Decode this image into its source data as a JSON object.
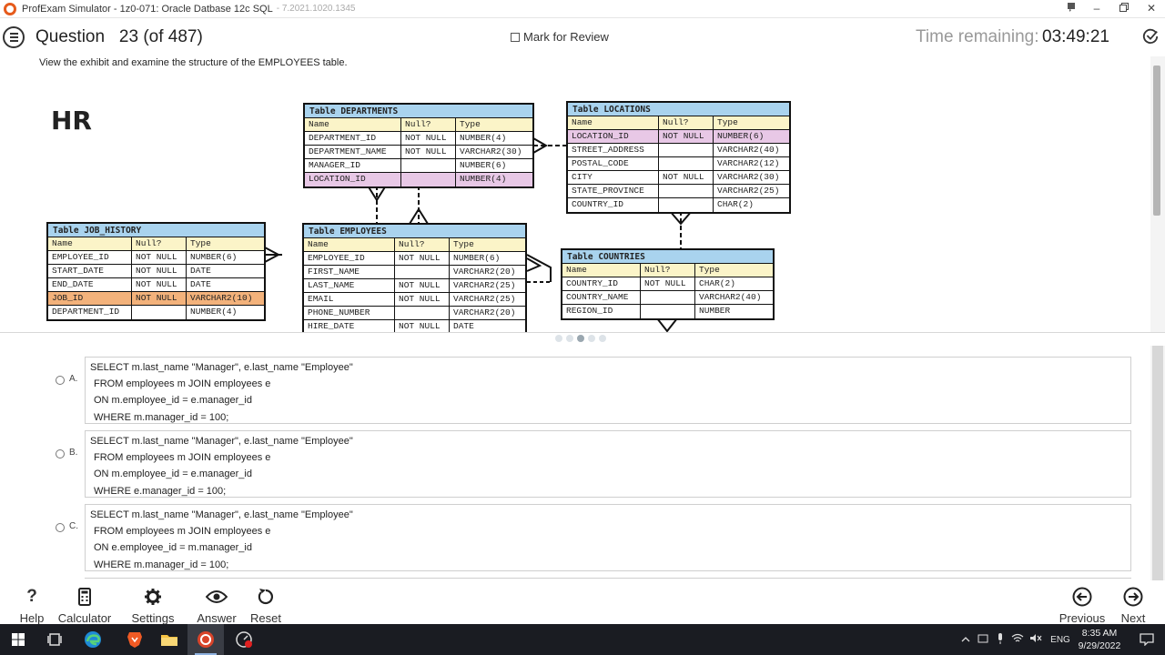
{
  "window": {
    "title": "ProfExam Simulator - 1z0-071: Oracle Datbase 12c SQL",
    "version": "- 7.2021.1020.1345"
  },
  "header": {
    "question_label": "Question",
    "question_number": "23",
    "question_of": "(of 487)",
    "mark_review": "Mark for Review",
    "time_label": "Time remaining:",
    "time_value": "03:49:21"
  },
  "question": {
    "text": "View the exhibit and examine the structure of the EMPLOYEES table.",
    "schema_label": "HR"
  },
  "exhibit": {
    "departments": {
      "title": "Table DEPARTMENTS",
      "columns": [
        "Name",
        "Null?",
        "Type"
      ],
      "rows": [
        [
          "DEPARTMENT_ID",
          "NOT NULL",
          "NUMBER(4)"
        ],
        [
          "DEPARTMENT_NAME",
          "NOT NULL",
          "VARCHAR2(30)"
        ],
        [
          "MANAGER_ID",
          "",
          "NUMBER(6)"
        ],
        [
          "LOCATION_ID",
          "",
          "NUMBER(4)"
        ]
      ]
    },
    "locations": {
      "title": "Table LOCATIONS",
      "columns": [
        "Name",
        "Null?",
        "Type"
      ],
      "rows": [
        [
          "LOCATION_ID",
          "NOT NULL",
          "NUMBER(6)"
        ],
        [
          "STREET_ADDRESS",
          "",
          "VARCHAR2(40)"
        ],
        [
          "POSTAL_CODE",
          "",
          "VARCHAR2(12)"
        ],
        [
          "CITY",
          "NOT NULL",
          "VARCHAR2(30)"
        ],
        [
          "STATE_PROVINCE",
          "",
          "VARCHAR2(25)"
        ],
        [
          "COUNTRY_ID",
          "",
          "CHAR(2)"
        ]
      ]
    },
    "job_history": {
      "title": "Table JOB_HISTORY",
      "columns": [
        "Name",
        "Null?",
        "Type"
      ],
      "rows": [
        [
          "EMPLOYEE_ID",
          "NOT NULL",
          "NUMBER(6)"
        ],
        [
          "START_DATE",
          "NOT NULL",
          "DATE"
        ],
        [
          "END_DATE",
          "NOT NULL",
          "DATE"
        ],
        [
          "JOB_ID",
          "NOT NULL",
          "VARCHAR2(10)"
        ],
        [
          "DEPARTMENT_ID",
          "",
          "NUMBER(4)"
        ]
      ]
    },
    "employees": {
      "title": "Table EMPLOYEES",
      "columns": [
        "Name",
        "Null?",
        "Type"
      ],
      "rows": [
        [
          "EMPLOYEE_ID",
          "NOT NULL",
          "NUMBER(6)"
        ],
        [
          "FIRST_NAME",
          "",
          "VARCHAR2(20)"
        ],
        [
          "LAST_NAME",
          "NOT NULL",
          "VARCHAR2(25)"
        ],
        [
          "EMAIL",
          "NOT NULL",
          "VARCHAR2(25)"
        ],
        [
          "PHONE_NUMBER",
          "",
          "VARCHAR2(20)"
        ],
        [
          "HIRE_DATE",
          "NOT NULL",
          "DATE"
        ]
      ]
    },
    "countries": {
      "title": "Table COUNTRIES",
      "columns": [
        "Name",
        "Null?",
        "Type"
      ],
      "rows": [
        [
          "COUNTRY_ID",
          "NOT NULL",
          "CHAR(2)"
        ],
        [
          "COUNTRY_NAME",
          "",
          "VARCHAR2(40)"
        ],
        [
          "REGION_ID",
          "",
          "NUMBER"
        ]
      ]
    }
  },
  "options": [
    {
      "letter": "A.",
      "lines": [
        "SELECT m.last_name \"Manager\", e.last_name \"Employee\"",
        "FROM employees m JOIN employees e",
        "ON m.employee_id = e.manager_id",
        "WHERE m.manager_id = 100;"
      ]
    },
    {
      "letter": "B.",
      "lines": [
        "SELECT m.last_name \"Manager\", e.last_name \"Employee\"",
        "FROM employees m JOIN employees e",
        "ON m.employee_id = e.manager_id",
        "WHERE e.manager_id = 100;"
      ]
    },
    {
      "letter": "C.",
      "lines": [
        "SELECT m.last_name \"Manager\", e.last_name \"Employee\"",
        "FROM employees m JOIN employees e",
        "ON e.employee_id = m.manager_id",
        "WHERE m.manager_id = 100;"
      ]
    }
  ],
  "toolbar": {
    "help": "Help",
    "help_glyph": "?",
    "calculator": "Calculator",
    "settings": "Settings",
    "answer": "Answer",
    "reset": "Reset",
    "previous": "Previous",
    "next": "Next"
  },
  "taskbar": {
    "language": "ENG",
    "time": "8:35 AM",
    "date": "9/29/2022"
  },
  "colors": {
    "table_header": "#a9d3ee",
    "column_header": "#fbf4c8",
    "fk_highlight": "#e8c8e6",
    "job_highlight": "#f3b27b"
  }
}
